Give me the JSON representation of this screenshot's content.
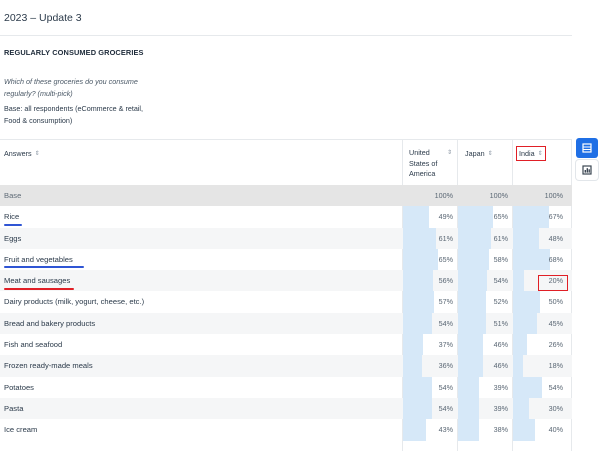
{
  "page": {
    "title": "2023 – Update 3"
  },
  "survey": {
    "title": "REGULARLY CONSUMED GROCERIES",
    "question": "Which of these groceries do you consume regularly? (multi-pick)",
    "base": "Base: all respondents (eCommerce & retail, Food & consumption)"
  },
  "table": {
    "headers": {
      "answers": "Answers",
      "col1": "United States of America",
      "col2": "Japan",
      "col3": "India"
    },
    "sort_glyph": "⇕",
    "rows": [
      {
        "label": "Base",
        "v1": "100%",
        "v2": "100%",
        "v3": "100%"
      },
      {
        "label": "Rice",
        "v1": "49%",
        "v2": "65%",
        "v3": "67%"
      },
      {
        "label": "Eggs",
        "v1": "61%",
        "v2": "61%",
        "v3": "48%"
      },
      {
        "label": "Fruit and vegetables",
        "v1": "65%",
        "v2": "58%",
        "v3": "68%"
      },
      {
        "label": "Meat and sausages",
        "v1": "56%",
        "v2": "54%",
        "v3": "20%"
      },
      {
        "label": "Dairy products (milk, yogurt, cheese, etc.)",
        "v1": "57%",
        "v2": "52%",
        "v3": "50%"
      },
      {
        "label": "Bread and bakery products",
        "v1": "54%",
        "v2": "51%",
        "v3": "45%"
      },
      {
        "label": "Fish and seafood",
        "v1": "37%",
        "v2": "46%",
        "v3": "26%"
      },
      {
        "label": "Frozen ready-made meals",
        "v1": "36%",
        "v2": "46%",
        "v3": "18%"
      },
      {
        "label": "Potatoes",
        "v1": "54%",
        "v2": "39%",
        "v3": "54%"
      },
      {
        "label": "Pasta",
        "v1": "54%",
        "v2": "39%",
        "v3": "30%"
      },
      {
        "label": "Ice cream",
        "v1": "43%",
        "v2": "38%",
        "v3": "40%"
      }
    ]
  },
  "colors": {
    "bar": "#d6e8f8",
    "highlight_red": "#e01f26",
    "underline_blue": "#2f55d4",
    "accent": "#1f6fe5"
  },
  "tools": {
    "table_view": "table-icon",
    "chart_view": "chart-icon"
  }
}
